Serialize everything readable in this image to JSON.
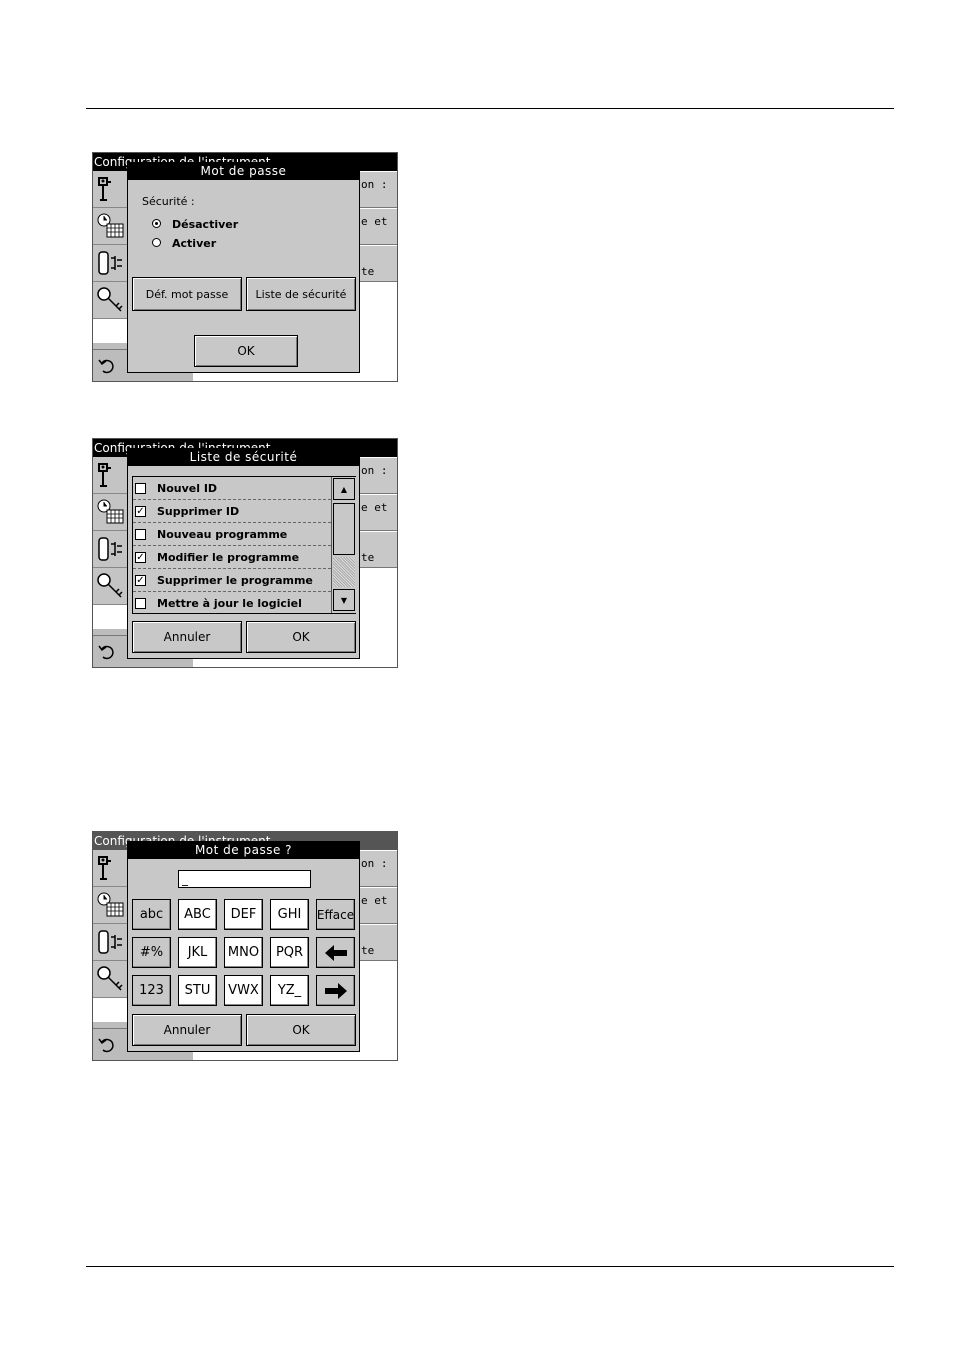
{
  "background_screen": {
    "title": "Configuration de l'instrument",
    "right_labels": [
      "on :",
      "e et",
      "te"
    ],
    "icons": [
      "instrument-info-icon",
      "clock-calendar-icon",
      "power-lamp-icon",
      "key-icon"
    ],
    "back_icon": "back-arrow-icon"
  },
  "dialog1": {
    "title": "Mot de passe",
    "section_label": "Sécurité :",
    "options": [
      {
        "label": "Désactiver",
        "selected": true
      },
      {
        "label": "Activer",
        "selected": false
      }
    ],
    "set_password_label": "Déf. mot passe",
    "security_list_label": "Liste de sécurité",
    "ok_label": "OK"
  },
  "dialog2": {
    "title": "Liste de sécurité",
    "items": [
      {
        "label": "Nouvel ID",
        "checked": false
      },
      {
        "label": "Supprimer ID",
        "checked": true
      },
      {
        "label": "Nouveau programme",
        "checked": false
      },
      {
        "label": "Modifier le programme",
        "checked": true
      },
      {
        "label": "Supprimer le programme",
        "checked": true
      },
      {
        "label": "Mettre à jour le logiciel",
        "checked": false
      }
    ],
    "cancel_label": "Annuler",
    "ok_label": "OK"
  },
  "dialog3": {
    "title": "Mot de passe ?",
    "field_value": "_",
    "keys_row1": [
      "abc",
      "ABC",
      "DEF",
      "GHI",
      "Efface"
    ],
    "keys_row2": [
      "#%",
      "JKL",
      "MNO",
      "PQR"
    ],
    "keys_row3": [
      "123",
      "STU",
      "VWX",
      "YZ_"
    ],
    "cancel_label": "Annuler",
    "ok_label": "OK"
  }
}
